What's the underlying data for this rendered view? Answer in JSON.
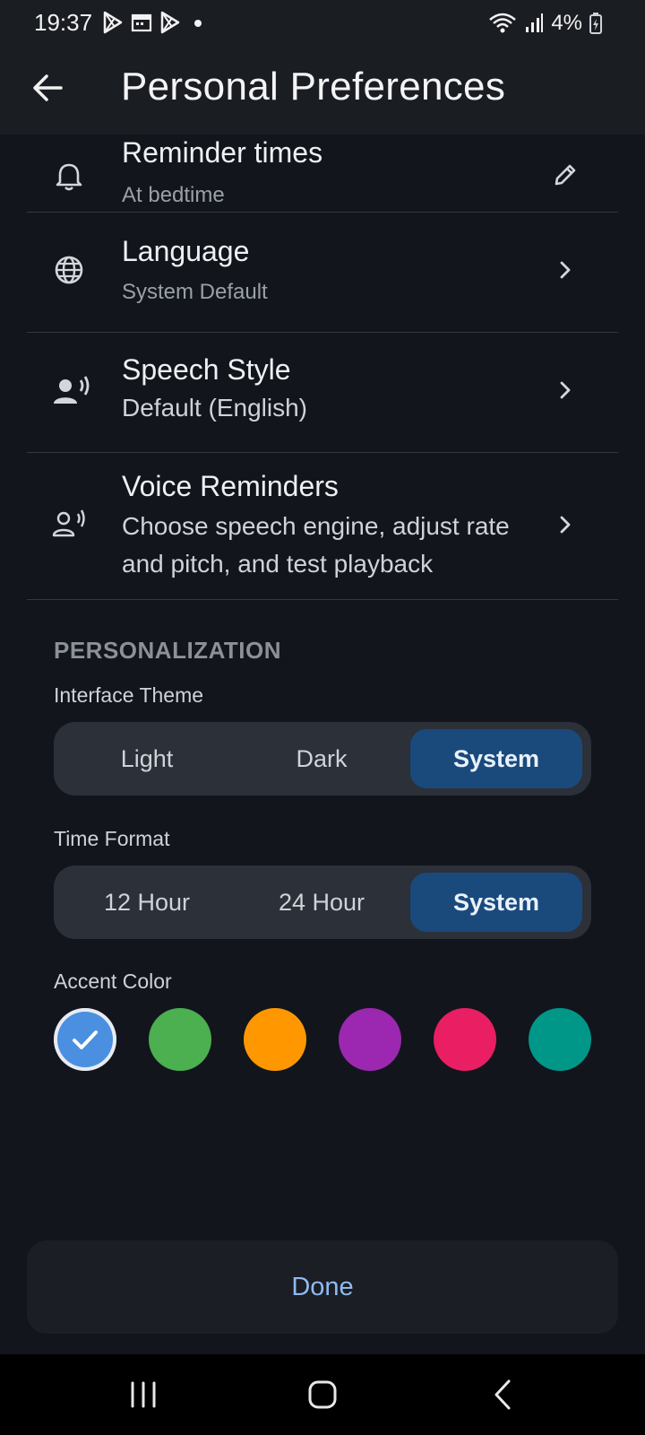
{
  "status_bar": {
    "time": "19:37",
    "battery": "4%",
    "icons": [
      "play-store-icon",
      "calendar-icon",
      "play-store-icon",
      "dot-icon",
      "wifi-icon",
      "signal-icon",
      "battery-icon"
    ]
  },
  "app_bar": {
    "title": "Personal Preferences",
    "back_icon": "arrow-left-icon"
  },
  "settings": [
    {
      "title": "Reminder times",
      "subtitle": "At bedtime",
      "icon": "bell-icon",
      "trail": "pencil-icon"
    },
    {
      "title": "Language",
      "subtitle": "System Default",
      "icon": "globe-icon",
      "trail": "chevron-right-icon"
    },
    {
      "title": "Speech Style",
      "subtitle": "Default (English)",
      "icon": "person-voice-icon",
      "trail": "chevron-right-icon"
    },
    {
      "title": "Voice Reminders",
      "subtitle": "Choose speech engine, adjust rate and pitch, and test playback",
      "icon": "person-voice-outline-icon",
      "trail": "chevron-right-icon"
    }
  ],
  "personalization": {
    "header": "PERSONALIZATION",
    "theme": {
      "label": "Interface Theme",
      "options": [
        "Light",
        "Dark",
        "System"
      ],
      "selected": "System"
    },
    "time_format": {
      "label": "Time Format",
      "options": [
        "12 Hour",
        "24 Hour",
        "System"
      ],
      "selected": "System"
    },
    "accent": {
      "label": "Accent Color",
      "colors": [
        "#4a8fe0",
        "#4caf50",
        "#ff9800",
        "#9c27b0",
        "#e91e63",
        "#009688"
      ],
      "selected_index": 0
    }
  },
  "done_label": "Done",
  "nav": [
    "recents-icon",
    "home-icon",
    "back-icon"
  ]
}
